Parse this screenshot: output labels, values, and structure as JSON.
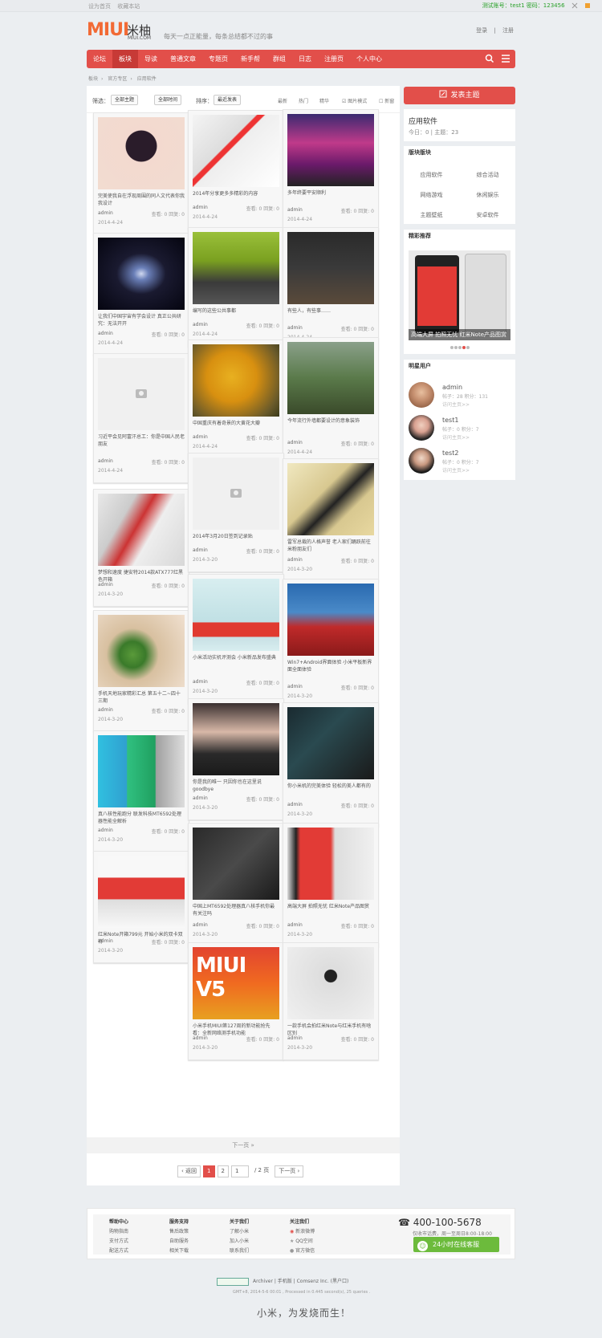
{
  "topbar": {
    "set_home": "设为首页",
    "bookmark": "收藏本站",
    "test_account": "测试账号：test1  密码：123456"
  },
  "logo": {
    "miui": "MIUI",
    "cn": "米柚",
    "en": "MIUI.COM"
  },
  "slogan": "每天一点正能量，每条总结都不过的事",
  "auth": {
    "login": "登录",
    "register": "注册"
  },
  "nav": {
    "items": [
      "论坛",
      "板块",
      "导读",
      "普通文章",
      "专题页",
      "新手帮",
      "群组",
      "日志",
      "注册页",
      "个人中心"
    ],
    "active_index": 1
  },
  "breadcrumb": [
    "板块",
    "官方专区",
    "应用软件"
  ],
  "filter": {
    "screen_label": "筛选：",
    "topic_select": "全部主题",
    "time_select": "全部时间",
    "sort_label": "排序：",
    "sort_select": "最近发表",
    "links": [
      "最新",
      "热门",
      "精华",
      "图片模式",
      "新窗"
    ]
  },
  "cards": [
    {
      "caption": "完美使我自在浮现周围的同人文代表你我我设计",
      "author": "admin",
      "stats": "查看: 0    回复: 0",
      "date": "2014-4-24"
    },
    {
      "caption": "2014年分享更多多精彩的内容",
      "author": "admin",
      "stats": "查看: 0    回复: 0",
      "date": "2014-4-24"
    },
    {
      "caption": "多年终要平安顺利",
      "author": "admin",
      "stats": "查看: 0    回复: 0",
      "date": "2014-4-24"
    },
    {
      "caption": "让我们中国宇宙有学会设计 真正公共研究：无法开开",
      "author": "admin",
      "stats": "查看: 0    回复: 0",
      "date": "2014-4-24"
    },
    {
      "caption": "编写的这些公共事都",
      "author": "admin",
      "stats": "查看: 0    回复: 0",
      "date": "2014-4-24"
    },
    {
      "caption": "有些人，有些事……",
      "author": "admin",
      "stats": "查看: 0    回复: 0",
      "date": "2014-4-24"
    },
    {
      "caption": "习近平会见阿富汗总工：你是中国人民老朋友",
      "author": "admin",
      "stats": "查看: 0    回复: 0",
      "date": "2014-4-24"
    },
    {
      "caption": "中国重庆有着奇景的大黄花大瓣",
      "author": "admin",
      "stats": "查看: 0    回复: 0",
      "date": "2014-4-24"
    },
    {
      "caption": "今年流行外墙都要设计的意象装饰",
      "author": "admin",
      "stats": "查看: 0    回复: 0",
      "date": "2014-4-24"
    },
    {
      "caption": "梦想和速度 捷安特2014款ATX777红黑色开箱",
      "author": "admin",
      "stats": "查看: 0    回复: 0",
      "date": "2014-3-20"
    },
    {
      "caption": "2014年3月20日签到记录贴",
      "author": "admin",
      "stats": "查看: 0    回复: 0",
      "date": "2014-3-20"
    },
    {
      "caption": "雷军总裁的人格声誉 老人家们踊跃前往米粉朋友们",
      "author": "admin",
      "stats": "查看: 0    回复: 0",
      "date": "2014-3-20"
    },
    {
      "caption": "手机天地玩家精彩汇总 第五十二~四十三期",
      "author": "admin",
      "stats": "查看: 0    回复: 0",
      "date": "2014-3-20"
    },
    {
      "caption": "小米活动实机评测会 小米新品发布盛典",
      "author": "admin",
      "stats": "查看: 0    回复: 0",
      "date": "2014-3-20"
    },
    {
      "caption": "Win7+Android界面体验 小米平板新界面全面体验",
      "author": "admin",
      "stats": "查看: 0    回复: 0",
      "date": "2014-3-20"
    },
    {
      "caption": "真八核性能跑分 联发科技MT6592处理器性能全解析",
      "author": "admin",
      "stats": "查看: 0    回复: 0",
      "date": "2014-3-20"
    },
    {
      "caption": "你是我的唯一 只因你也在这里说goodbye",
      "author": "admin",
      "stats": "查看: 0    回复: 0",
      "date": "2014-3-20"
    },
    {
      "caption": "你小米机的完美体验 轻松的美人都有的",
      "author": "admin",
      "stats": "查看: 0    回复: 0",
      "date": "2014-3-20"
    },
    {
      "caption": "红米Note开箱799元 开始小米的双卡双待",
      "author": "admin",
      "stats": "查看: 0    回复: 0",
      "date": "2014-3-20"
    },
    {
      "caption": "中国上MT6592处理器真八核手机你最有关注吗",
      "author": "admin",
      "stats": "查看: 0    回复: 0",
      "date": "2014-3-20"
    },
    {
      "caption": "高端大屏 拍照无忧 红米Note产品图赏",
      "author": "admin",
      "stats": "查看: 0    回复: 0",
      "date": "2014-3-20"
    },
    {
      "caption": "小米手机MIUI第127周的新功能抢先看：全新网络测手机功能",
      "author": "admin",
      "stats": "查看: 0    回复: 0",
      "date": "2014-3-20"
    },
    {
      "caption": "一款手机会拍红米Note与红米手机有啥区别",
      "author": "admin",
      "stats": "查看: 0    回复: 0",
      "date": "2014-3-20"
    }
  ],
  "pagination": {
    "next_bar": "下一页 »",
    "prev": "‹ 返回",
    "current": "1",
    "page2": "2",
    "input_value": "1",
    "total": "/ 2 页",
    "next": "下一页 ›"
  },
  "sidebar": {
    "post_button": "发表主题",
    "forum_name": "应用软件",
    "forum_stats": "今日：0 | 主题：23",
    "forums_title": "版块版块",
    "forums": [
      "应用软件",
      "综合活动",
      "网络游戏",
      "休闲娱乐",
      "主题壁纸",
      "安卓软件"
    ],
    "featured_title": "精彩推荐",
    "featured_caption": "高端大屏 拍照无忧 红米Note产品图赏",
    "users_title": "明星用户",
    "users": [
      {
        "name": "admin",
        "info": "帖子：28  积分：131",
        "link": "访问主页>>"
      },
      {
        "name": "test1",
        "info": "帖子：0  积分：7",
        "link": "访问主页>>"
      },
      {
        "name": "test2",
        "info": "帖子：0  积分：7",
        "link": "访问主页>>"
      }
    ]
  },
  "footer": {
    "cols": [
      {
        "head": "帮助中心",
        "links": [
          "购物指南",
          "支付方式",
          "配送方式"
        ]
      },
      {
        "head": "服务支持",
        "links": [
          "售后政策",
          "自助服务",
          "相关下载"
        ]
      },
      {
        "head": "关于我们",
        "links": [
          "了解小米",
          "加入小米",
          "联系我们"
        ]
      },
      {
        "head": "关注我们",
        "links": [
          "新浪微博",
          "QQ空间",
          "官方微信"
        ]
      }
    ],
    "phone": "400-100-5678",
    "hours": "仅收市话费，周一至周日8:00-18:00",
    "cs_button": "24小时在线客服",
    "line1": "Archiver | 手机版 | Comsenz Inc. (黑户口)",
    "line2": "GMT+8, 2014-5-6 00:01 , Processed in 0.445 second(s), 25 queries .",
    "slogan": "小米，为发烧而生！"
  },
  "colors": {
    "accent": "#e24f4a",
    "green": "#6cbb3c"
  }
}
